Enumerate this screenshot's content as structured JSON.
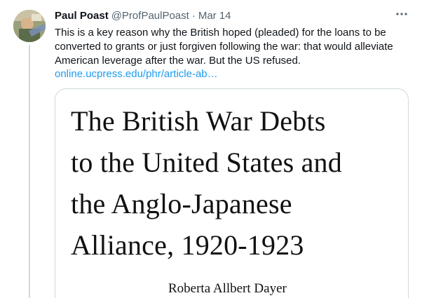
{
  "tweet": {
    "author": {
      "display_name": "Paul Poast",
      "handle": "@ProfPaulPoast"
    },
    "separator": "·",
    "date": "Mar 14",
    "more_label": "···",
    "text": "This is a key reason why the British hoped (pleaded) for the loans to be converted to grants or just forgiven following the war: that would alleviate American leverage after the war. But the US refused.",
    "link_text": "online.ucpress.edu/phr/article-ab…"
  },
  "card": {
    "title": "The British War Debts\nto the United States and\nthe Anglo-Japanese\nAlliance, 1920-1923",
    "author": "Roberta Allbert Dayer"
  },
  "colors": {
    "primary_text": "#0f1419",
    "secondary_text": "#536471",
    "link": "#1d9bf0",
    "border": "#cfd9de"
  },
  "icons": {
    "more": "more-horizontal-icon",
    "avatar": "profile-avatar"
  }
}
